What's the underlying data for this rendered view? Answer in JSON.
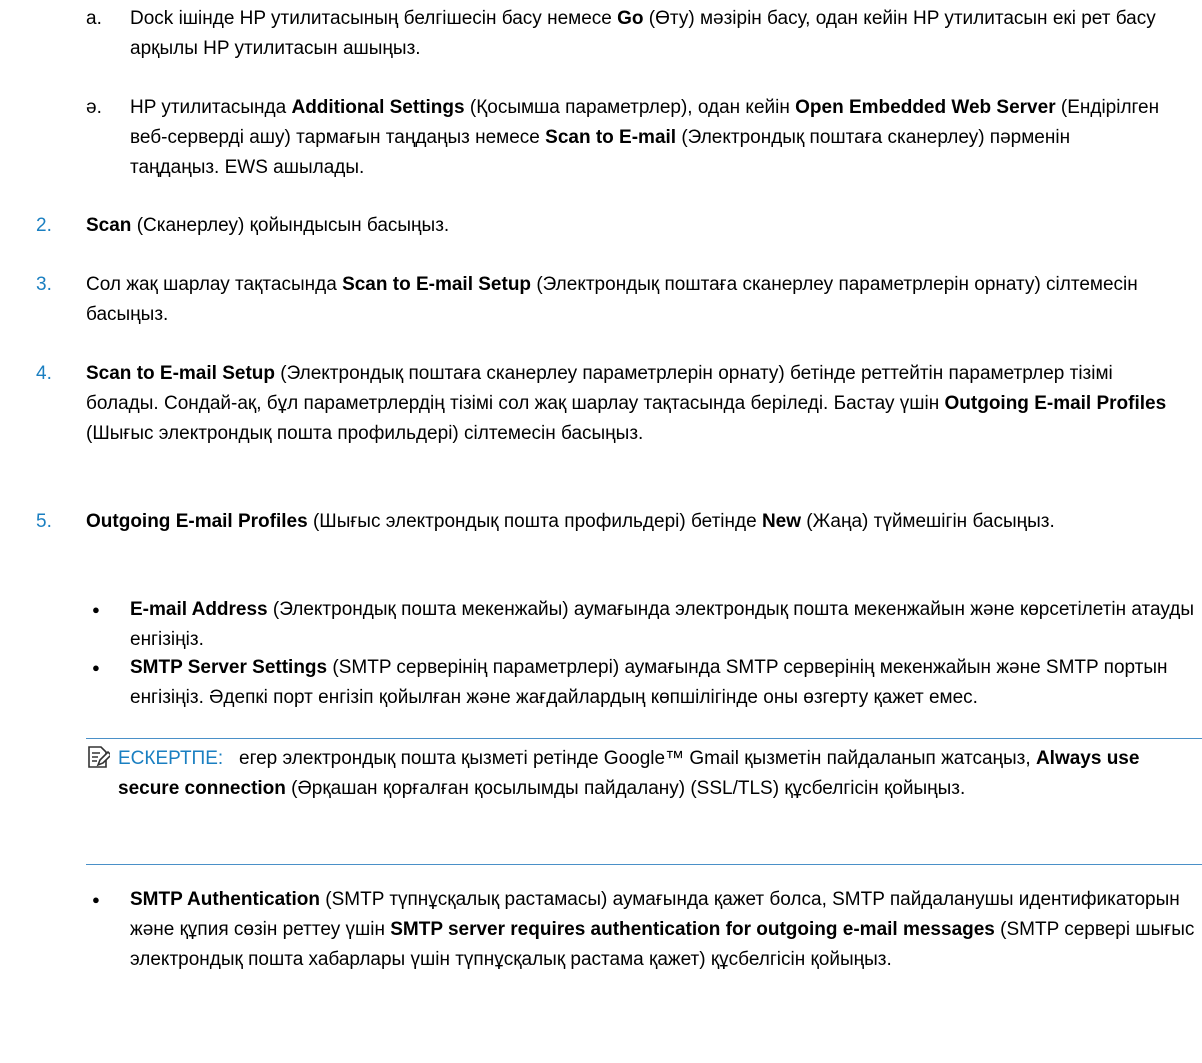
{
  "steps": [
    {
      "marker": "а.",
      "text": "Dock ішінде HP утилитасының белгішесін басу немесе Go (Өту) мәзірін басу, одан кейін HP утилитасын екі рет басу арқылы HP утилитасын ашыңыз."
    },
    {
      "marker": "ә.",
      "text": "HP утилитасында Additional Settings (Қосымша параметрлер), одан кейін Open Embedded Web Server (Ендірілген веб-серверді ашу) тармағын таңдаңыз немесе Scan to E-mail (Электрондық поштаға сканерлеу) пәрменін таңдаңыз. EWS ашылады."
    },
    {
      "marker": "2.",
      "text": "Scan (Сканерлеу) қойындысын басыңыз."
    },
    {
      "marker": "3.",
      "text": "Сол жақ шарлау тақтасында Scan to E-mail Setup (Электрондық поштаға сканерлеу параметрлерін орнату) сілтемесін басыңыз."
    },
    {
      "marker": "4.",
      "text": "Scan to E-mail Setup (Электрондық поштаға сканерлеу параметрлерін орнату) бетінде реттейтін параметрлер тізімі болады. Сондай-ақ, бұл параметрлердің тізімі сол жақ шарлау тақтасында беріледі. Бастау үшін Outgoing E-mail Profiles (Шығыс электрондық пошта профильдері) сілтемесін басыңыз."
    },
    {
      "marker": "5.",
      "text": "Outgoing E-mail Profiles (Шығыс электрондық пошта профильдері) бетінде New (Жаңа) түймешігін басыңыз."
    }
  ],
  "bullets": [
    {
      "marker": "●",
      "text": "E-mail Address (Электрондық пошта мекенжайы) аумағында электрондық пошта мекенжайын және көрсетілетін атауды енгізіңіз."
    },
    {
      "marker": "●",
      "text": "SMTP Server Settings (SMTP серверінің параметрлері) аумағында SMTP серверінің мекенжайын және SMTP портын енгізіңіз. Әдепкі порт енгізіп қойылған және жағдайлардың көпшілігінде оны өзгерту қажет емес."
    },
    {
      "marker": "●",
      "text": "SMTP Authentication (SMTP түпнұсқалық растамасы) аумағында қажет болса, SMTP пайдаланушы идентификаторын және құпия сөзін реттеу үшін SMTP server requires authentication for outgoing e-mail messages (SMTP сервері шығыс электрондық пошта хабарлары үшін түпнұсқалық растама қажет) құсбелгісін қойыңыз."
    }
  ],
  "note": {
    "label": "ЕСКЕРТПЕ:",
    "text": "егер электрондық пошта қызметі ретінде Google™ Gmail қызметін пайдаланып жатсаңыз, Always use secure connection (Әрқашан қорғалған қосылымды пайдалану) (SSL/TLS) құсбелгісін қойыңыз."
  },
  "bold_terms": [
    "Go",
    "Additional Settings",
    "Open Embedded Web Server",
    "Scan to E-mail",
    "Scan",
    "Scan to E-mail Setup",
    "Outgoing E-mail Profiles",
    "New",
    "E-mail Address",
    "SMTP Server Settings",
    "SMTP Authentication",
    "SMTP server requires authentication for outgoing e-mail messages",
    "Always use secure connection"
  ],
  "colors": {
    "accent": "#1a7fc1",
    "rule": "#4a90c8"
  }
}
